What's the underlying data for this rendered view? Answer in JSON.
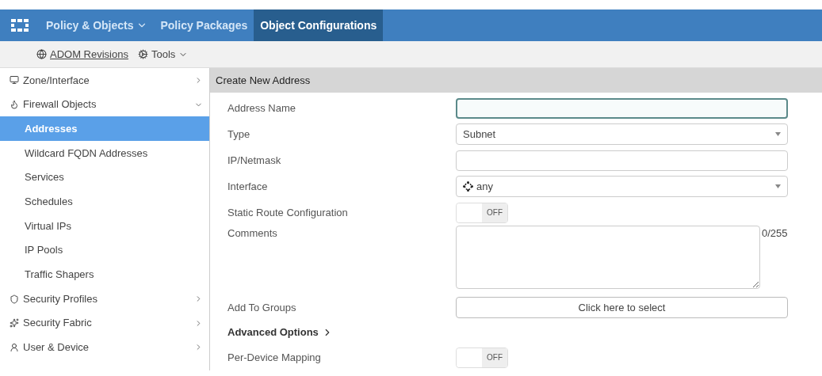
{
  "top_nav": {
    "tabs": [
      {
        "label": "Policy & Objects",
        "dropdown": true,
        "selected": false
      },
      {
        "label": "Policy Packages",
        "dropdown": false,
        "selected": false
      },
      {
        "label": "Object Configurations",
        "dropdown": false,
        "selected": true
      }
    ]
  },
  "toolbar": {
    "items": [
      {
        "label": "ADOM Revisions",
        "kind": "link"
      },
      {
        "label": "Tools",
        "kind": "menu"
      }
    ]
  },
  "sidebar": {
    "items": [
      {
        "label": "Zone/Interface",
        "expanded": false,
        "selected": false
      },
      {
        "label": "Firewall Objects",
        "expanded": true,
        "selected": false,
        "children": [
          {
            "label": "Addresses",
            "selected": true
          },
          {
            "label": "Wildcard FQDN Addresses",
            "selected": false
          },
          {
            "label": "Services",
            "selected": false
          },
          {
            "label": "Schedules",
            "selected": false
          },
          {
            "label": "Virtual IPs",
            "selected": false
          },
          {
            "label": "IP Pools",
            "selected": false
          },
          {
            "label": "Traffic Shapers",
            "selected": false
          }
        ]
      },
      {
        "label": "Security Profiles",
        "expanded": false,
        "selected": false
      },
      {
        "label": "Security Fabric",
        "expanded": false,
        "selected": false
      },
      {
        "label": "User & Device",
        "expanded": false,
        "selected": false
      }
    ]
  },
  "form": {
    "title": "Create New Address",
    "fields": [
      {
        "label": "Address Name",
        "kind": "text",
        "focused": true
      },
      {
        "label": "Type",
        "kind": "select",
        "value": "Subnet"
      },
      {
        "label": "IP/Netmask",
        "kind": "text",
        "focused": false
      },
      {
        "label": "Interface",
        "kind": "select",
        "value": "any",
        "icon": true
      },
      {
        "label": "Static Route Configuration",
        "kind": "toggle",
        "on": false,
        "state_text": "OFF"
      },
      {
        "label": "Comments",
        "kind": "textarea",
        "counter": "0/255"
      },
      {
        "label": "Add To Groups",
        "kind": "picker",
        "value": "Click here to select"
      },
      {
        "label": "Advanced Options",
        "kind": "section"
      },
      {
        "label": "Per-Device Mapping",
        "kind": "toggle",
        "on": false,
        "state_text": "OFF"
      }
    ]
  }
}
